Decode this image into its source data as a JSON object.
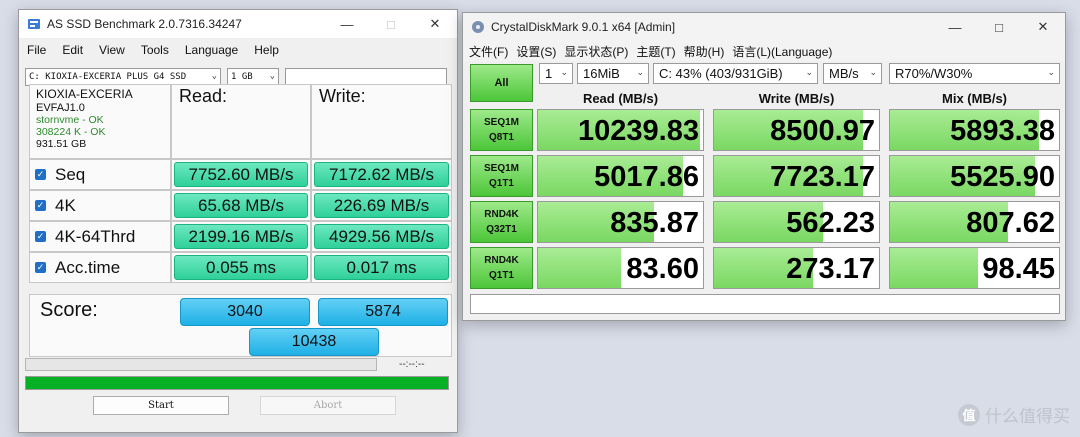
{
  "asssd": {
    "title": "AS SSD Benchmark 2.0.7316.34247",
    "menu": [
      "File",
      "Edit",
      "View",
      "Tools",
      "Language",
      "Help"
    ],
    "drive_select": "C: KIOXIA-EXCERIA PLUS G4 SSD",
    "size_select": "1 GB",
    "info": {
      "model": "KIOXIA-EXCERIA",
      "firmware": "EVFAJ1.0",
      "driver": "stornvme - OK",
      "alignment": "308224 K - OK",
      "capacity": "931.51 GB"
    },
    "headers": {
      "read": "Read:",
      "write": "Write:"
    },
    "rows": [
      {
        "label": "Seq",
        "read": "7752.60 MB/s",
        "write": "7172.62 MB/s"
      },
      {
        "label": "4K",
        "read": "65.68 MB/s",
        "write": "226.69 MB/s"
      },
      {
        "label": "4K-64Thrd",
        "read": "2199.16 MB/s",
        "write": "4929.56 MB/s"
      },
      {
        "label": "Acc.time",
        "read": "0.055 ms",
        "write": "0.017 ms"
      }
    ],
    "score": {
      "label": "Score:",
      "read": "3040",
      "write": "5874",
      "total": "10438"
    },
    "time_display": "--:--:--",
    "progress": 1.0,
    "buttons": {
      "start": "Start",
      "abort": "Abort"
    }
  },
  "cdm": {
    "title": "CrystalDiskMark 9.0.1 x64 [Admin]",
    "menu": [
      "文件(F)",
      "设置(S)",
      "显示状态(P)",
      "主题(T)",
      "帮助(H)",
      "语言(L)(Language)"
    ],
    "all_label": "All",
    "count": "1",
    "size": "16MiB",
    "drive": "C: 43% (403/931GiB)",
    "unit": "MB/s",
    "profile": "R70%/W30%",
    "col_headers": [
      "Read (MB/s)",
      "Write (MB/s)",
      "Mix (MB/s)"
    ],
    "tests": [
      {
        "line1": "SEQ1M",
        "line2": "Q8T1",
        "read": "10239.83",
        "write": "8500.97",
        "mix": "5893.38",
        "read_pct": 0.98,
        "write_pct": 0.9,
        "mix_pct": 0.88
      },
      {
        "line1": "SEQ1M",
        "line2": "Q1T1",
        "read": "5017.86",
        "write": "7723.17",
        "mix": "5525.90",
        "read_pct": 0.88,
        "write_pct": 0.9,
        "mix_pct": 0.86
      },
      {
        "line1": "RND4K",
        "line2": "Q32T1",
        "read": "835.87",
        "write": "562.23",
        "mix": "807.62",
        "read_pct": 0.7,
        "write_pct": 0.66,
        "mix_pct": 0.7
      },
      {
        "line1": "RND4K",
        "line2": "Q1T1",
        "read": "83.60",
        "write": "273.17",
        "mix": "98.45",
        "read_pct": 0.5,
        "write_pct": 0.6,
        "mix_pct": 0.52
      }
    ],
    "comment": ""
  },
  "watermark": {
    "text": "什么值得买",
    "badge": "值"
  },
  "colors": {
    "green_pill": "#2fd09a",
    "blue_pill": "#1eb0e6",
    "cdm_green": "#4cc639",
    "progress": "#06b025"
  }
}
